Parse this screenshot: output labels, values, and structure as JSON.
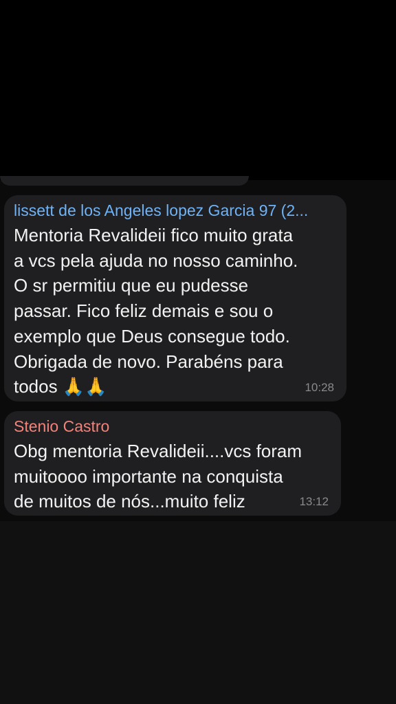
{
  "messages": [
    {
      "sender": "lissett de los Angeles lopez Garcia 97 (2...",
      "sender_color": "#6fb2f5",
      "text": "Mentoria Revalideii fico muito grata\na vcs pela ajuda no nosso caminho.\nO sr permitiu que eu pudesse\npassar. Fico feliz demais e sou o\nexemplo que Deus consegue todo.\nObrigada de novo. Parabéns para\ntodos",
      "emoji": "🙏🙏",
      "time": "10:28"
    },
    {
      "sender": "Stenio Castro",
      "sender_color": "#f2837b",
      "text": "Obg mentoria Revalideii....vcs foram\nmuitoooo importante na conquista\nde muitos de nós...muito feliz",
      "time": "13:12"
    }
  ],
  "colors": {
    "bubble": "#1f1f21",
    "background": "#0b0b0c",
    "timestamp": "#8a8a8e"
  }
}
